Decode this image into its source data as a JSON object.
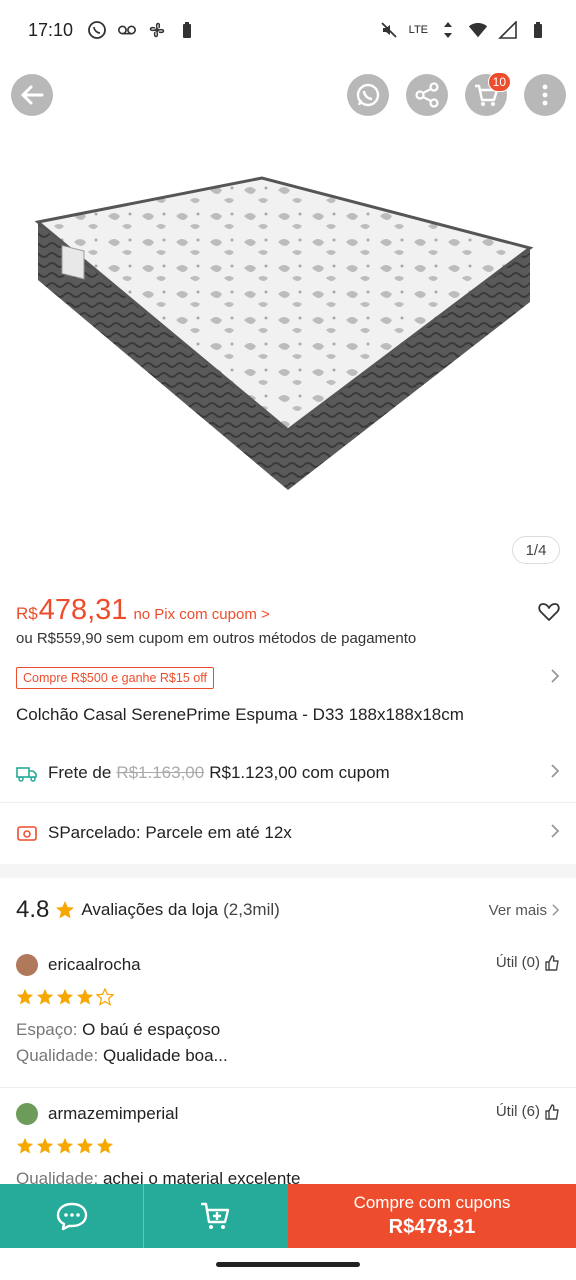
{
  "status_bar": {
    "time": "17:10",
    "network": "LTE"
  },
  "top_bar": {
    "cart_badge": "10"
  },
  "gallery": {
    "counter": "1/4"
  },
  "price": {
    "currency": "R$",
    "value": "478,31",
    "pix_label": "no Pix com cupom >",
    "alt_price": "ou R$559,90 sem cupom em outros métodos de pagamento"
  },
  "voucher": {
    "label": "Compre R$500 e ganhe R$15 off"
  },
  "product": {
    "title": "Colchão Casal SerenePrime Espuma - D33 188x188x18cm"
  },
  "shipping": {
    "label": "Frete de",
    "old_price": "R$1.163,00",
    "new_price": "R$1.123,00 com cupom"
  },
  "installments": {
    "label": "SParcelado: Parcele em até 12x"
  },
  "reviews": {
    "rating": "4.8",
    "label": "Avaliações da loja",
    "count": "(2,3mil)",
    "see_more": "Ver mais",
    "items": [
      {
        "username": "ericaalrocha",
        "util": "Útil (0)",
        "stars": 4,
        "lines": [
          {
            "label": "Espaço:",
            "text": "O baú é espaçoso"
          },
          {
            "label": "Qualidade:",
            "text": "Qualidade boa..."
          }
        ]
      },
      {
        "username": "armazemimperial",
        "util": "Útil (6)",
        "stars": 5,
        "lines": [
          {
            "label": "Qualidade:",
            "text": "achei o material excelente"
          }
        ]
      }
    ]
  },
  "bottom_bar": {
    "buy_label": "Compre com cupons",
    "buy_price": "R$478,31"
  },
  "colors": {
    "brand": "#ee4d2d",
    "teal": "#26aa99",
    "star": "#f6a700"
  }
}
